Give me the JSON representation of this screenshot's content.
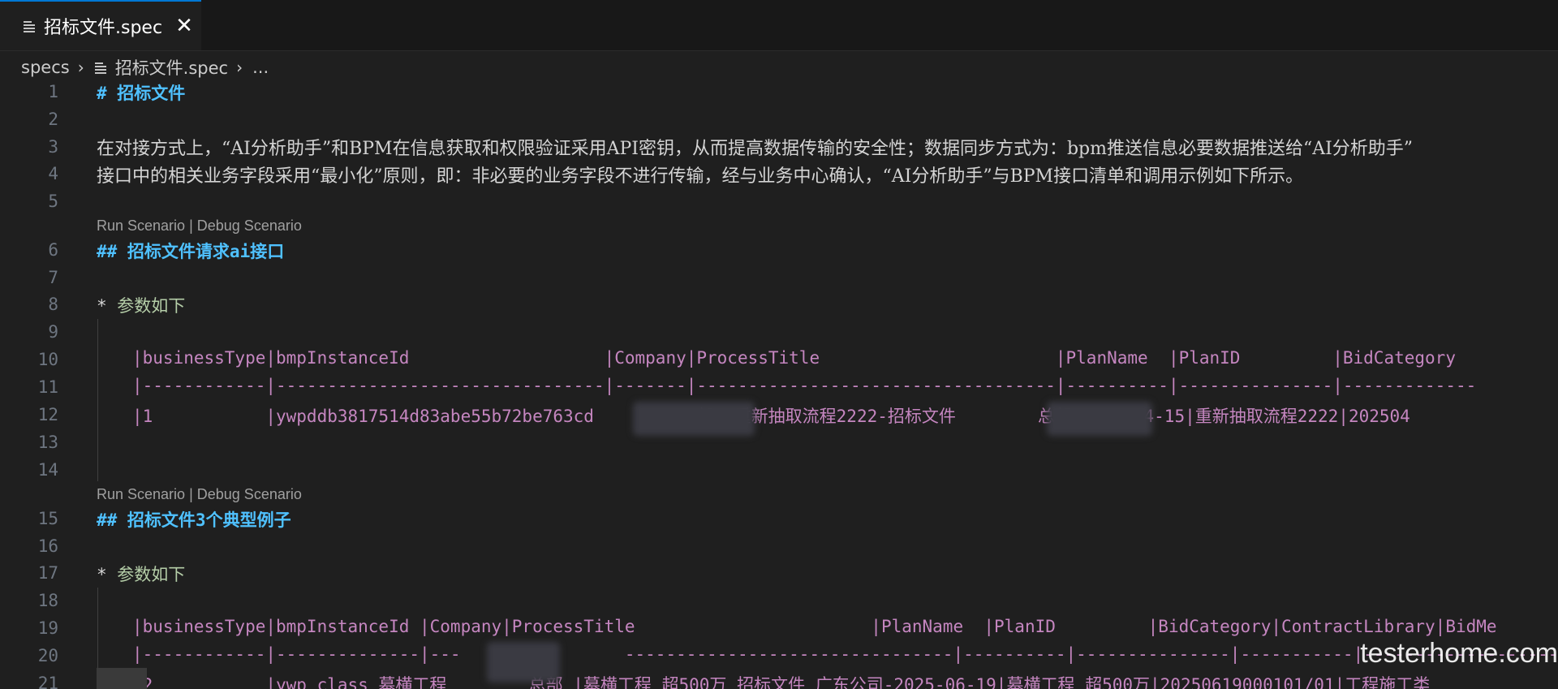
{
  "tab": {
    "label": "招标文件.spec",
    "close": "✕"
  },
  "breadcrumb": {
    "folder": "specs",
    "file": "招标文件.spec",
    "more": "..."
  },
  "codelens": {
    "run": "Run Scenario",
    "divider": " | ",
    "debug": "Debug Scenario"
  },
  "lines": {
    "l1": "# 招标文件",
    "l3": "在对接方式上，“AI分析助手”和BPM在信息获取和权限验证采用API密钥，从而提高数据传输的安全性；数据同步方式为：bpm推送信息必要数据推送给“AI分析助手”",
    "l4": "接口中的相关业务字段采用“最小化”原则，即：非必要的业务字段不进行传输，经与业务中心确认，“AI分析助手”与BPM接口清单和调用示例如下所示。",
    "l6": "## 招标文件请求ai接口",
    "l8_star": "* ",
    "l8_text": "参数如下",
    "l10": "|businessType|bmpInstanceId                   |Company|ProcessTitle                       |PlanName  |PlanID         |BidCategory",
    "l11": "|------------|--------------------------------|-------|-----------------------------------|----------|---------------|-------------",
    "l12": "|1           |ywpddb3817514d83abe55b72be763cd          部 |重新抽取流程2222-招标文件        总部-2025-04-15|重新抽取流程2222|202504",
    "l15": "## 招标文件3个典型例子",
    "l17_star": "* ",
    "l17_text": "参数如下",
    "l19": "|businessType|bmpInstanceId |Company|ProcessTitle                       |PlanName  |PlanID         |BidCategory|ContractLibrary|BidMe",
    "l20": "|------------|--------------|---                --------------------------------|----------|---------------|-----------|-------------------",
    "l21": "|2           |ywp_class 墓横工程        总部 |墓横工程 超500万 招标文件 广东公司-2025-06-19|墓横工程 超500万|20250619000101/01|工程施工类"
  },
  "line_numbers": [
    "1",
    "2",
    "3",
    "4",
    "5",
    "6",
    "7",
    "8",
    "9",
    "10",
    "11",
    "12",
    "13",
    "14",
    "15",
    "16",
    "17",
    "18",
    "19",
    "20",
    "21"
  ],
  "watermark": "testerhome.com",
  "colors": {
    "heading": "#4fc1ff",
    "table": "#c586c0",
    "bullet_text": "#b5cea8",
    "accent": "#0078d4"
  }
}
